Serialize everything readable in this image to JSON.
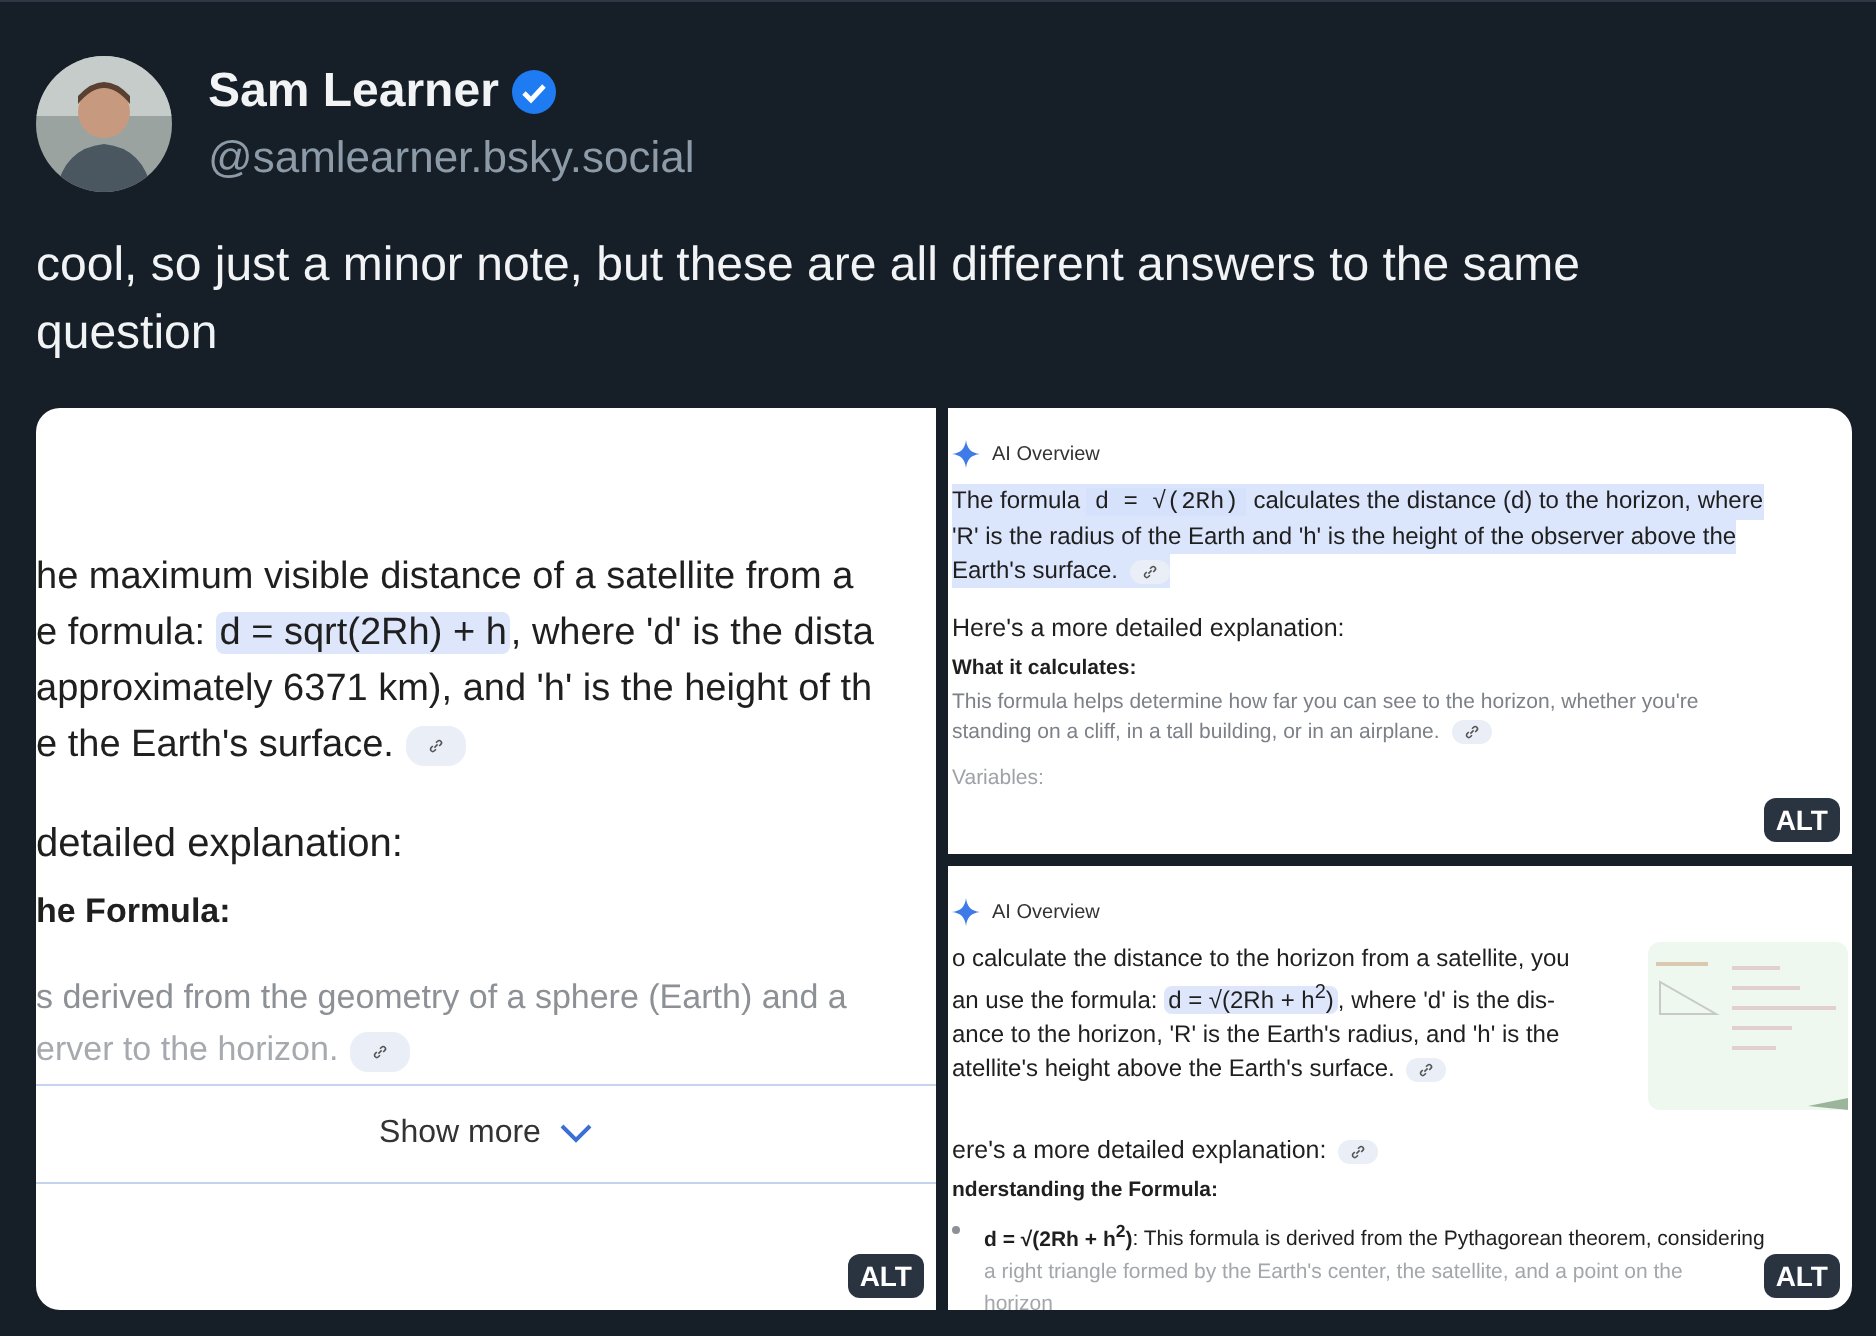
{
  "post": {
    "author": "Sam Learner",
    "verified": true,
    "handle": "@samlearner.bsky.social",
    "text": "cool, so just a minor note, but these are all different answers to the same question"
  },
  "images": [
    {
      "kind": "search_result",
      "alt": "ALT",
      "show_more": "Show more",
      "blocks": [
        {
          "kind": "para",
          "highlighted": false,
          "link_chip": true,
          "lines": [
            [
              {
                "kind": "plain",
                "text": "he maximum visible distance of a satellite from a"
              }
            ],
            [
              {
                "kind": "plain",
                "text": "e formula: "
              },
              {
                "kind": "formula",
                "text": "d = sqrt(2Rh) + h"
              },
              {
                "kind": "plain",
                "text": ", where 'd' is the dista"
              }
            ],
            [
              {
                "kind": "plain",
                "text": "approximately 6371 km), and 'h' is the height of th"
              }
            ],
            [
              {
                "kind": "plain",
                "text": "e the Earth's surface."
              }
            ]
          ]
        },
        {
          "kind": "heading",
          "link_chip": false,
          "lines": [
            [
              {
                "kind": "plain",
                "text": "detailed explanation:"
              }
            ]
          ]
        },
        {
          "kind": "subheading",
          "link_chip": false,
          "lines": [
            [
              {
                "kind": "plain",
                "text": "he Formula:"
              }
            ]
          ]
        },
        {
          "kind": "muted",
          "link_chip": false,
          "lines": [
            [
              {
                "kind": "plain",
                "text": "s derived from the geometry of a sphere (Earth) and a"
              }
            ]
          ]
        },
        {
          "kind": "faded",
          "link_chip": true,
          "lines": [
            [
              {
                "kind": "plain",
                "text": "erver to the horizon."
              }
            ]
          ]
        }
      ]
    },
    {
      "kind": "ai_overview",
      "header": "AI Overview",
      "alt": "ALT",
      "blocks": [
        {
          "kind": "para",
          "highlighted": true,
          "link_chip": true,
          "lines": [
            [
              {
                "kind": "plain",
                "text": "The formula "
              },
              {
                "kind": "code",
                "text": "d = √(2Rh)"
              },
              {
                "kind": "plain",
                "text": " calculates the distance (d) to the horizon, where"
              }
            ],
            [
              {
                "kind": "plain",
                "text": "'R' is the radius of the Earth and 'h' is the height of the observer above the"
              }
            ],
            [
              {
                "kind": "plain",
                "text": "Earth's surface."
              }
            ]
          ]
        },
        {
          "kind": "heading",
          "link_chip": false,
          "lines": [
            [
              {
                "kind": "plain",
                "text": "Here's a more detailed explanation:"
              }
            ]
          ]
        },
        {
          "kind": "subheading",
          "link_chip": false,
          "lines": [
            [
              {
                "kind": "plain",
                "text": "What it calculates:"
              }
            ]
          ]
        },
        {
          "kind": "muted",
          "link_chip": true,
          "lines": [
            [
              {
                "kind": "plain",
                "text": "This formula helps determine how far you can see to the horizon, whether you're"
              }
            ],
            [
              {
                "kind": "plain",
                "text": "standing on a cliff, in a tall building, or in an airplane."
              }
            ]
          ]
        },
        {
          "kind": "faded",
          "link_chip": false,
          "lines": [
            [
              {
                "kind": "plain",
                "text": "Variables:"
              }
            ]
          ]
        }
      ]
    },
    {
      "kind": "ai_overview",
      "header": "AI Overview",
      "alt": "ALT",
      "blocks": [
        {
          "kind": "para",
          "highlighted": false,
          "link_chip": true,
          "thumbnail": {
            "kind": "picture"
          },
          "lines": [
            [
              {
                "kind": "plain",
                "text": "o calculate the distance to the horizon from a satellite, you"
              }
            ],
            [
              {
                "kind": "plain",
                "text": "an use the formula: "
              },
              {
                "kind": "formula",
                "text": "d = √(2Rh + h$^{2}$)"
              },
              {
                "kind": "plain",
                "text": ", where 'd' is the dis-"
              }
            ],
            [
              {
                "kind": "plain",
                "text": "ance to the horizon, 'R' is the Earth's radius, and 'h' is the"
              }
            ],
            [
              {
                "kind": "plain",
                "text": "atellite's height above the Earth's surface."
              }
            ]
          ]
        },
        {
          "kind": "heading",
          "link_chip": true,
          "lines": [
            [
              {
                "kind": "plain",
                "text": "ere's a more detailed explanation:"
              }
            ]
          ]
        },
        {
          "kind": "subheading",
          "link_chip": false,
          "lines": [
            [
              {
                "kind": "plain",
                "text": "nderstanding the Formula:"
              }
            ]
          ]
        },
        {
          "kind": "bullet",
          "link_chip": false,
          "lines": [
            [
              {
                "kind": "bold",
                "text": "d = √(2Rh + h$^{2}$)"
              },
              {
                "kind": "plain",
                "text": ": This formula is derived from the Pythagorean theorem, considering"
              }
            ],
            [
              {
                "kind": "faded",
                "text": "a right triangle formed by the Earth's center, the satellite, and a point on the"
              }
            ],
            [
              {
                "kind": "faded",
                "text": "horizon"
              }
            ]
          ]
        }
      ]
    }
  ]
}
